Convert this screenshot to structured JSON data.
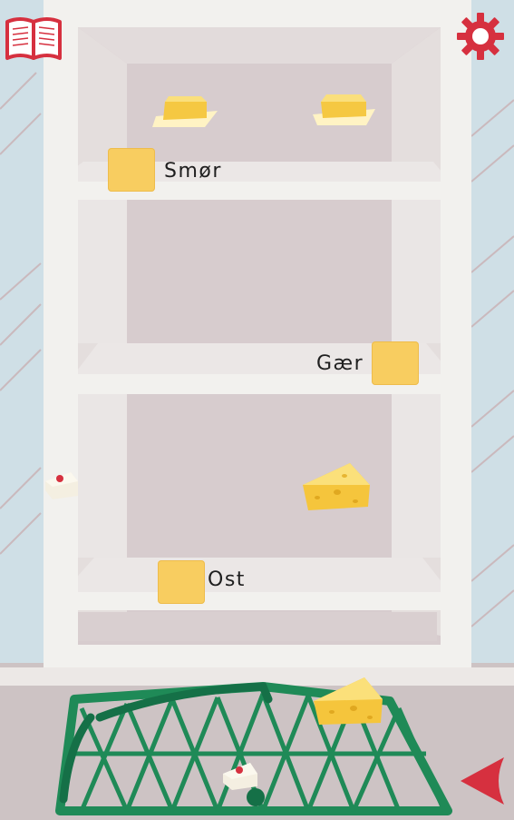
{
  "top_bar": {
    "recipe_book_icon": "open-book-icon",
    "settings_icon": "gear-icon"
  },
  "shelves": {
    "top": {
      "label": "Smør"
    },
    "middle": {
      "label": "Gær"
    },
    "bottom": {
      "label": "Ost"
    }
  },
  "items": {
    "butter": "butter",
    "cheese": "cheese",
    "yeast": "yeast-package"
  },
  "nav": {
    "back_icon": "back-arrow-icon"
  },
  "colors": {
    "accent_red": "#d6303f",
    "slot_yellow": "#f8cd60",
    "basket_green": "#1f8a57",
    "fridge_white": "#f2f1ee",
    "fridge_interior": "#d7ccce",
    "wall_blue": "#cfdfe6",
    "floor": "#cdc3c4"
  }
}
